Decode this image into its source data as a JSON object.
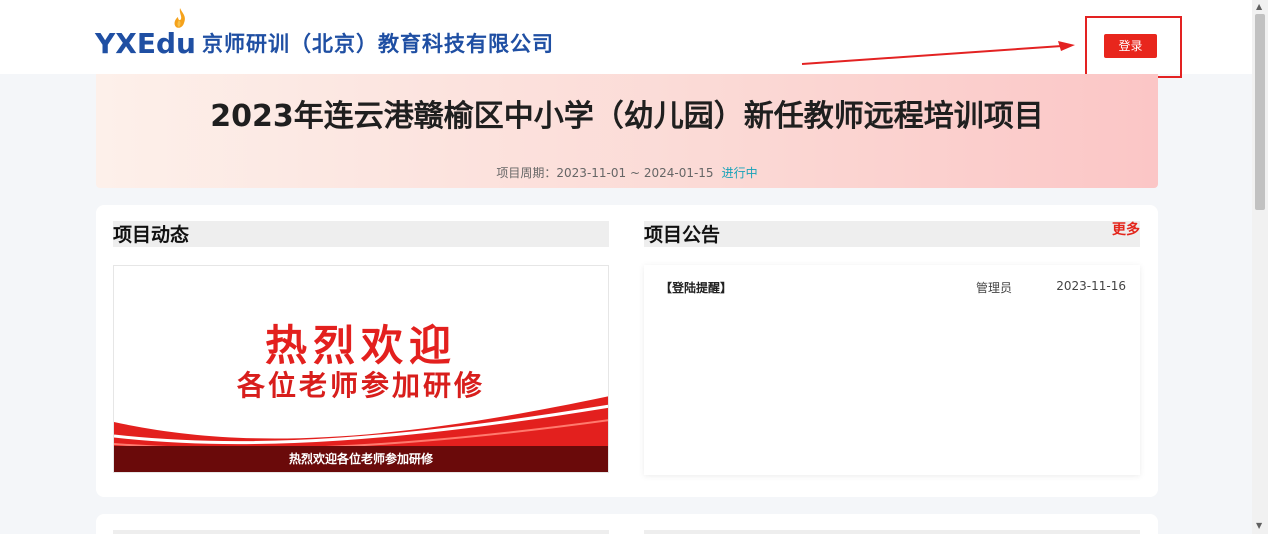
{
  "header": {
    "logo_text": "YXEdu",
    "company_name": "京师研训（北京）教育科技有限公司",
    "login_label": "登录"
  },
  "banner": {
    "title": "2023年连云港赣榆区中小学（幼儿园）新任教师远程培训项目",
    "period_label": "项目周期：2023-11-01 ~ 2024-01-15",
    "status": "进行中"
  },
  "news": {
    "title": "项目动态",
    "image_line1": "热烈欢迎",
    "image_line2": "各位老师参加研修",
    "caption": "热烈欢迎各位老师参加研修"
  },
  "notices": {
    "title": "项目公告",
    "more_label": "更多",
    "items": [
      {
        "title": "【登陆提醒】",
        "author": "管理员",
        "date": "2023-11-16"
      }
    ]
  },
  "colors": {
    "brand_blue": "#1f4fa3",
    "accent_red": "#e8261d",
    "status_teal": "#17a2b8"
  }
}
